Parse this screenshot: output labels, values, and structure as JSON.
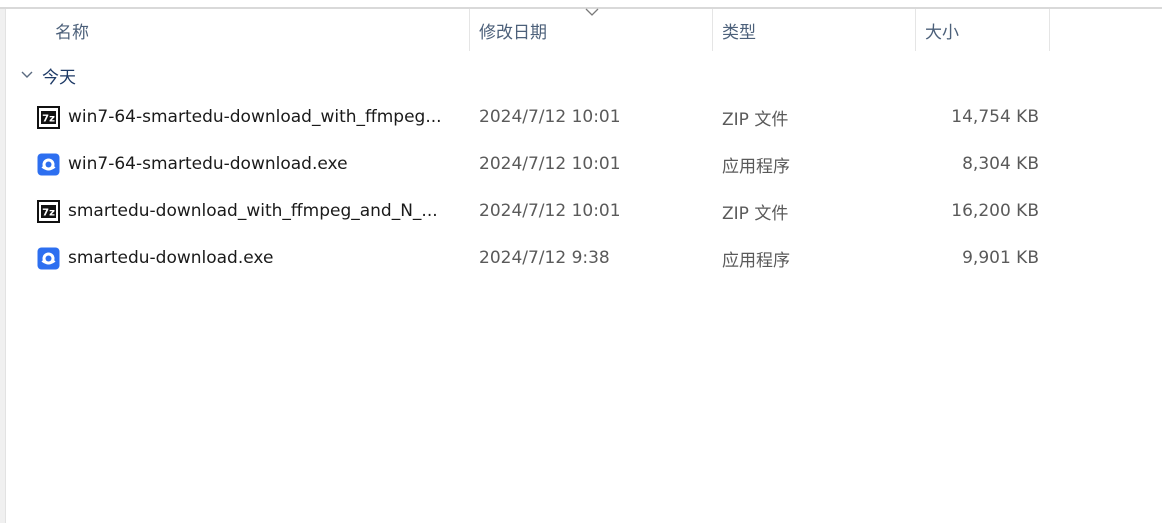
{
  "columns": {
    "name": "名称",
    "date": "修改日期",
    "type": "类型",
    "size": "大小"
  },
  "group": {
    "label": "今天"
  },
  "files": [
    {
      "name": "win7-64-smartedu-download_with_ffmpeg...",
      "date": "2024/7/12 10:01",
      "type": "ZIP 文件",
      "size": "14,754 KB",
      "icon": "7zip-icon"
    },
    {
      "name": "win7-64-smartedu-download.exe",
      "date": "2024/7/12 10:01",
      "type": "应用程序",
      "size": "8,304 KB",
      "icon": "app-icon"
    },
    {
      "name": "smartedu-download_with_ffmpeg_and_N_...",
      "date": "2024/7/12 10:01",
      "type": "ZIP 文件",
      "size": "16,200 KB",
      "icon": "7zip-icon"
    },
    {
      "name": "smartedu-download.exe",
      "date": "2024/7/12 9:38",
      "type": "应用程序",
      "size": "9,901 KB",
      "icon": "app-icon"
    }
  ],
  "colors": {
    "header_text": "#4c607a",
    "group_text": "#1e3a66",
    "app_icon_blue": "#2d6ff0"
  }
}
